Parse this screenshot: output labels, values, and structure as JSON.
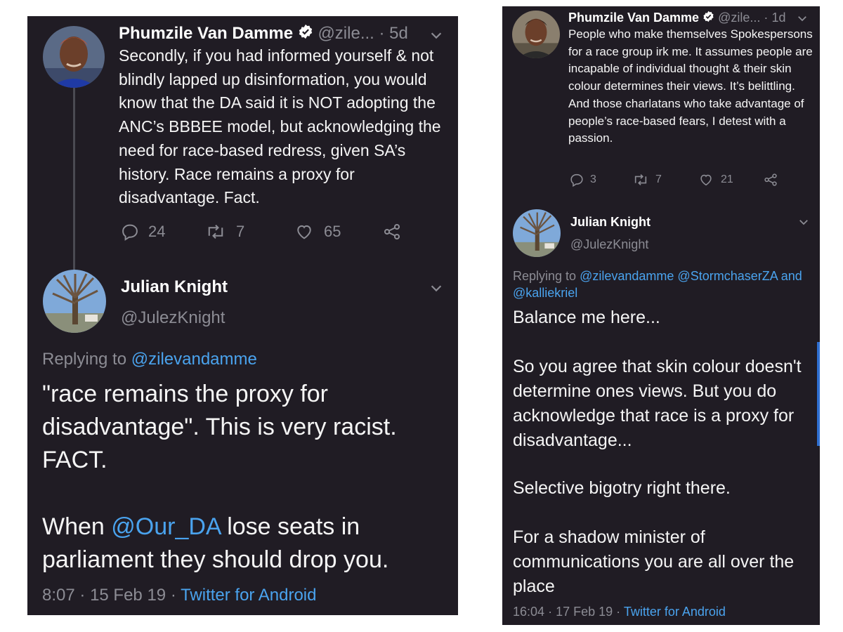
{
  "left": {
    "tweet": {
      "name": "Phumzile Van Damme",
      "handle": "@zile...",
      "sep": "·",
      "age": "5d",
      "text": "Secondly, if you had informed yourself & not blindly lapped up disinformation, you would know that the DA said it is NOT adopting the ANC’s BBBEE model, but acknowledging the need for race-based redress, given SA’s history. Race remains a proxy for disadvantage. Fact.",
      "replies": "24",
      "retweets": "7",
      "likes": "65"
    },
    "reply": {
      "name": "Julian Knight",
      "handle": "@JulezKnight",
      "replying_prefix": "Replying to",
      "replying_to": "@zilevandamme",
      "p1": "\"race remains the proxy for disadvantage\". This is very racist. FACT.",
      "p2_before": "When",
      "p2_mention": "@Our_DA",
      "p2_after": "lose seats in parliament they should drop you.",
      "time": "8:07",
      "date": "15 Feb 19",
      "source": "Twitter for Android"
    }
  },
  "right": {
    "tweet": {
      "name": "Phumzile Van Damme",
      "handle": "@zile...",
      "sep": "·",
      "age": "1d",
      "text": "People who make themselves Spokespersons for a race group irk me. It assumes people are incapable of individual thought & their skin colour determines their views. It’s belittling. And those charlatans who take advantage of people’s race-based fears, I detest with a passion.",
      "replies": "3",
      "retweets": "7",
      "likes": "21"
    },
    "reply": {
      "name": "Julian Knight",
      "handle": "@JulezKnight",
      "replying_prefix": "Replying to",
      "replying_to_1": "@zilevandamme",
      "replying_to_2": "@StormchaserZA",
      "replying_and": "and",
      "replying_to_3": "@kalliekriel",
      "p1": "Balance me here...",
      "p2": "So you agree that skin colour doesn't determine ones views. But you do acknowledge that race is a proxy for disadvantage...",
      "p3": "Selective bigotry right there.",
      "p4": "For a shadow minister of communications you are all over the place",
      "time": "16:04",
      "date": "17 Feb 19",
      "source": "Twitter for Android"
    }
  },
  "icons": {
    "verified": "verified-badge-icon",
    "chevron": "chevron-down-icon",
    "reply": "reply-icon",
    "retweet": "retweet-icon",
    "like": "like-icon",
    "share": "share-icon"
  },
  "colors": {
    "background": "#201c24",
    "link": "#4aa3ee",
    "muted": "#8c8c94",
    "verified": "#ffffff"
  }
}
